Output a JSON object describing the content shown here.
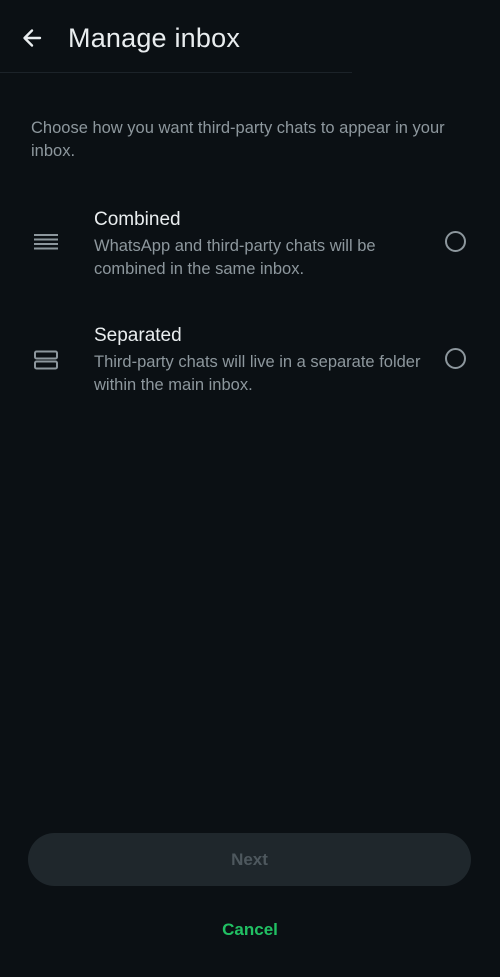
{
  "header": {
    "title": "Manage inbox",
    "back_icon": "arrow-left-icon"
  },
  "intro": "Choose how you want third-party chats to appear in your inbox.",
  "options": [
    {
      "title": "Combined",
      "description": "WhatsApp and third-party chats will be combined in the same inbox.",
      "icon": "stacked-lines-icon",
      "selected": false
    },
    {
      "title": "Separated",
      "description": "Third-party chats will live in a separate folder within the main inbox.",
      "icon": "split-boxes-icon",
      "selected": false
    }
  ],
  "footer": {
    "next_label": "Next",
    "next_enabled": false,
    "cancel_label": "Cancel"
  },
  "colors": {
    "background": "#0b1014",
    "accent": "#21c063",
    "secondary_text": "#8d979d",
    "disabled_button": "#1f272c"
  }
}
